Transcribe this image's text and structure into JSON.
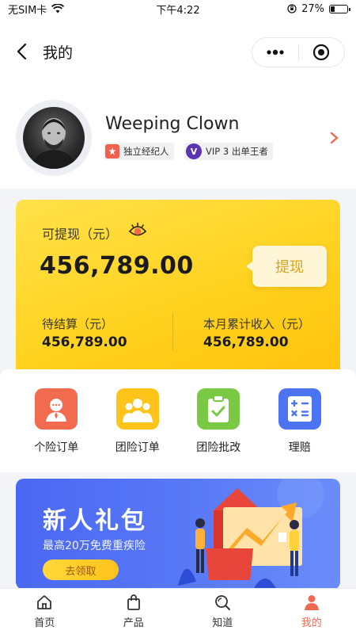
{
  "status_bar": {
    "carrier": "无SIM卡",
    "time": "下午4:22",
    "battery": "27%",
    "battery_level": 0.27
  },
  "nav": {
    "title": "我的"
  },
  "profile": {
    "name": "Weeping Clown",
    "tags": [
      {
        "label": "独立经纪人"
      },
      {
        "badge": "V",
        "label": "VIP 3 出单王者"
      }
    ]
  },
  "wallet": {
    "withdrawable_label": "可提现（元）",
    "withdrawable_amount": "456,789.00",
    "withdraw_button": "提现",
    "pending_label": "待结算（元）",
    "pending_amount": "456,789.00",
    "monthly_label": "本月累计收入（元）",
    "monthly_amount": "456,789.00"
  },
  "menu": [
    {
      "label": "个险订单",
      "icon": "personal-order-icon",
      "color": "#f26b4f"
    },
    {
      "label": "团险订单",
      "icon": "group-order-icon",
      "color": "#ffc41a"
    },
    {
      "label": "团险批改",
      "icon": "group-endorse-icon",
      "color": "#7ac943"
    },
    {
      "label": "理赔",
      "icon": "claims-icon",
      "color": "#4b73f2"
    }
  ],
  "banner": {
    "title": "新人礼包",
    "subtitle": "最高20万免费重疾险",
    "button": "去领取"
  },
  "tabbar": [
    {
      "label": "首页",
      "icon": "home-icon"
    },
    {
      "label": "产品",
      "icon": "bag-icon"
    },
    {
      "label": "知道",
      "icon": "search-icon"
    },
    {
      "label": "我的",
      "icon": "user-icon",
      "active": true
    }
  ]
}
